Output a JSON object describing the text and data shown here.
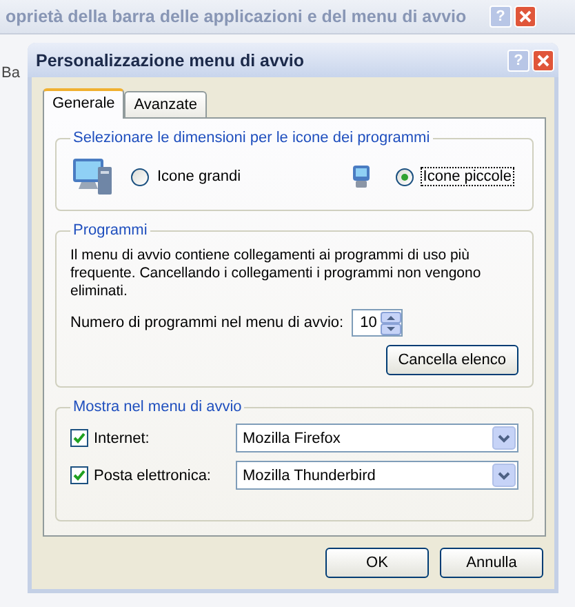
{
  "back_window": {
    "title": "oprietà della barra delle applicazioni e del menu di avvio",
    "help": "?",
    "tab_fragment": "Ba"
  },
  "window": {
    "title": "Personalizzazione menu di avvio",
    "help": "?"
  },
  "tabs": [
    {
      "label": "Generale",
      "selected": true
    },
    {
      "label": "Avanzate",
      "selected": false
    }
  ],
  "icon_size_group": {
    "title": "Selezionare le dimensioni per le icone dei programmi",
    "options": [
      {
        "kind": "large",
        "label": "Icone grandi",
        "selected": false
      },
      {
        "kind": "small",
        "label": "Icone piccole",
        "selected": true
      }
    ]
  },
  "programs_group": {
    "title": "Programmi",
    "description": "Il menu di avvio contiene collegamenti ai programmi di uso più frequente. Cancellando i collegamenti i programmi non vengono eliminati.",
    "count_label": "Numero di programmi nel menu di avvio:",
    "count_value": "10",
    "clear_button": "Cancella elenco"
  },
  "show_group": {
    "title": "Mostra nel menu di avvio",
    "rows": [
      {
        "label": "Internet:",
        "checked": true,
        "value": "Mozilla Firefox"
      },
      {
        "label": "Posta elettronica:",
        "checked": true,
        "value": "Mozilla Thunderbird"
      }
    ]
  },
  "buttons": [
    "OK",
    "Annulla"
  ]
}
